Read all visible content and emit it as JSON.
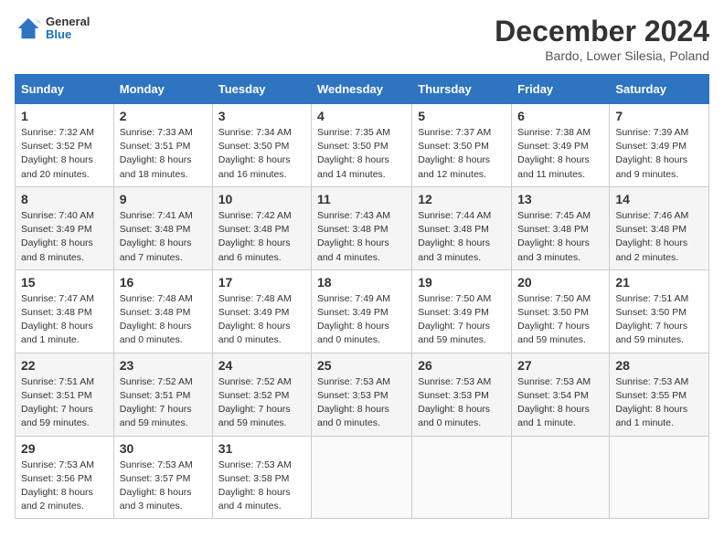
{
  "header": {
    "logo_general": "General",
    "logo_blue": "Blue",
    "month_title": "December 2024",
    "subtitle": "Bardo, Lower Silesia, Poland"
  },
  "days_of_week": [
    "Sunday",
    "Monday",
    "Tuesday",
    "Wednesday",
    "Thursday",
    "Friday",
    "Saturday"
  ],
  "weeks": [
    [
      {
        "day": "1",
        "sunrise": "7:32 AM",
        "sunset": "3:52 PM",
        "daylight": "8 hours and 20 minutes."
      },
      {
        "day": "2",
        "sunrise": "7:33 AM",
        "sunset": "3:51 PM",
        "daylight": "8 hours and 18 minutes."
      },
      {
        "day": "3",
        "sunrise": "7:34 AM",
        "sunset": "3:50 PM",
        "daylight": "8 hours and 16 minutes."
      },
      {
        "day": "4",
        "sunrise": "7:35 AM",
        "sunset": "3:50 PM",
        "daylight": "8 hours and 14 minutes."
      },
      {
        "day": "5",
        "sunrise": "7:37 AM",
        "sunset": "3:50 PM",
        "daylight": "8 hours and 12 minutes."
      },
      {
        "day": "6",
        "sunrise": "7:38 AM",
        "sunset": "3:49 PM",
        "daylight": "8 hours and 11 minutes."
      },
      {
        "day": "7",
        "sunrise": "7:39 AM",
        "sunset": "3:49 PM",
        "daylight": "8 hours and 9 minutes."
      }
    ],
    [
      {
        "day": "8",
        "sunrise": "7:40 AM",
        "sunset": "3:49 PM",
        "daylight": "8 hours and 8 minutes."
      },
      {
        "day": "9",
        "sunrise": "7:41 AM",
        "sunset": "3:48 PM",
        "daylight": "8 hours and 7 minutes."
      },
      {
        "day": "10",
        "sunrise": "7:42 AM",
        "sunset": "3:48 PM",
        "daylight": "8 hours and 6 minutes."
      },
      {
        "day": "11",
        "sunrise": "7:43 AM",
        "sunset": "3:48 PM",
        "daylight": "8 hours and 4 minutes."
      },
      {
        "day": "12",
        "sunrise": "7:44 AM",
        "sunset": "3:48 PM",
        "daylight": "8 hours and 3 minutes."
      },
      {
        "day": "13",
        "sunrise": "7:45 AM",
        "sunset": "3:48 PM",
        "daylight": "8 hours and 3 minutes."
      },
      {
        "day": "14",
        "sunrise": "7:46 AM",
        "sunset": "3:48 PM",
        "daylight": "8 hours and 2 minutes."
      }
    ],
    [
      {
        "day": "15",
        "sunrise": "7:47 AM",
        "sunset": "3:48 PM",
        "daylight": "8 hours and 1 minute."
      },
      {
        "day": "16",
        "sunrise": "7:48 AM",
        "sunset": "3:48 PM",
        "daylight": "8 hours and 0 minutes."
      },
      {
        "day": "17",
        "sunrise": "7:48 AM",
        "sunset": "3:49 PM",
        "daylight": "8 hours and 0 minutes."
      },
      {
        "day": "18",
        "sunrise": "7:49 AM",
        "sunset": "3:49 PM",
        "daylight": "8 hours and 0 minutes."
      },
      {
        "day": "19",
        "sunrise": "7:50 AM",
        "sunset": "3:49 PM",
        "daylight": "7 hours and 59 minutes."
      },
      {
        "day": "20",
        "sunrise": "7:50 AM",
        "sunset": "3:50 PM",
        "daylight": "7 hours and 59 minutes."
      },
      {
        "day": "21",
        "sunrise": "7:51 AM",
        "sunset": "3:50 PM",
        "daylight": "7 hours and 59 minutes."
      }
    ],
    [
      {
        "day": "22",
        "sunrise": "7:51 AM",
        "sunset": "3:51 PM",
        "daylight": "7 hours and 59 minutes."
      },
      {
        "day": "23",
        "sunrise": "7:52 AM",
        "sunset": "3:51 PM",
        "daylight": "7 hours and 59 minutes."
      },
      {
        "day": "24",
        "sunrise": "7:52 AM",
        "sunset": "3:52 PM",
        "daylight": "7 hours and 59 minutes."
      },
      {
        "day": "25",
        "sunrise": "7:53 AM",
        "sunset": "3:53 PM",
        "daylight": "8 hours and 0 minutes."
      },
      {
        "day": "26",
        "sunrise": "7:53 AM",
        "sunset": "3:53 PM",
        "daylight": "8 hours and 0 minutes."
      },
      {
        "day": "27",
        "sunrise": "7:53 AM",
        "sunset": "3:54 PM",
        "daylight": "8 hours and 1 minute."
      },
      {
        "day": "28",
        "sunrise": "7:53 AM",
        "sunset": "3:55 PM",
        "daylight": "8 hours and 1 minute."
      }
    ],
    [
      {
        "day": "29",
        "sunrise": "7:53 AM",
        "sunset": "3:56 PM",
        "daylight": "8 hours and 2 minutes."
      },
      {
        "day": "30",
        "sunrise": "7:53 AM",
        "sunset": "3:57 PM",
        "daylight": "8 hours and 3 minutes."
      },
      {
        "day": "31",
        "sunrise": "7:53 AM",
        "sunset": "3:58 PM",
        "daylight": "8 hours and 4 minutes."
      },
      null,
      null,
      null,
      null
    ]
  ]
}
